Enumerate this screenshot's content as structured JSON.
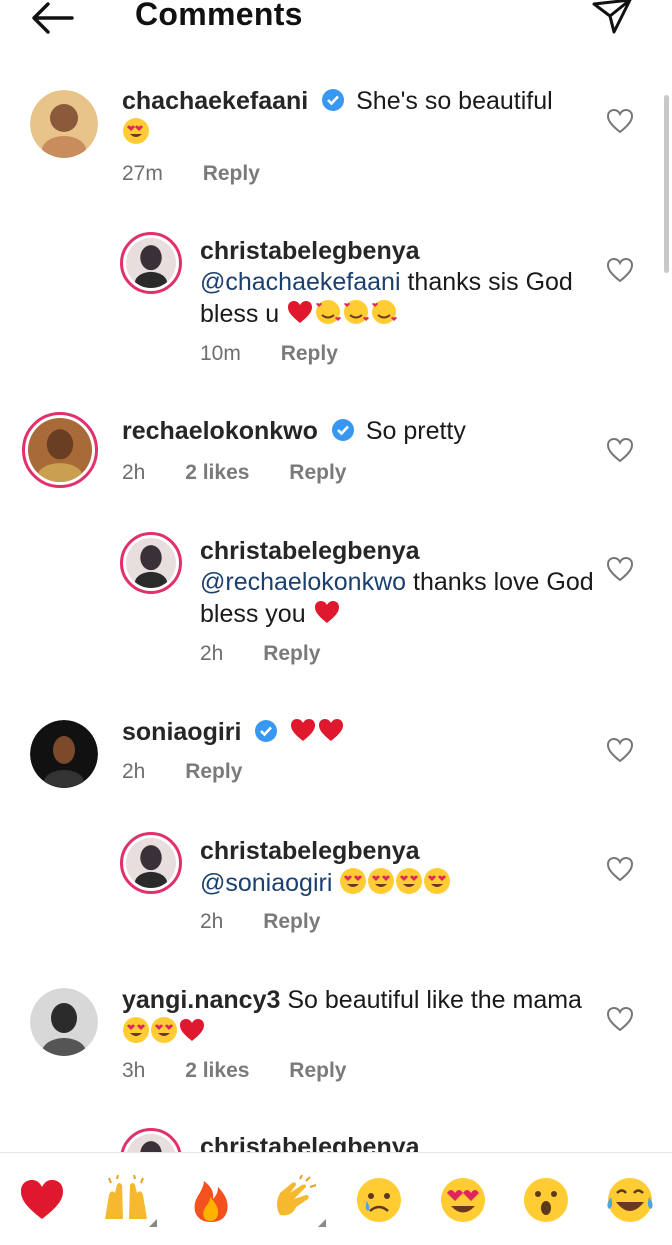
{
  "header": {
    "title": "Comments",
    "back_icon": "arrow-left-icon",
    "send_icon": "paper-plane-icon"
  },
  "comments": [
    {
      "username": "chachaekefaani",
      "verified": true,
      "text": "She's so beautiful",
      "emojis": [
        "heart-eyes"
      ],
      "time": "27m",
      "likes": "",
      "reply_label": "Reply",
      "avatar_color": "#d9a86c"
    },
    {
      "username": "christabelegbenya",
      "verified": false,
      "mention": "@chachaekefaani",
      "text": "thanks sis God bless u",
      "emojis": [
        "red-heart",
        "smiling-hearts",
        "smiling-hearts",
        "smiling-hearts"
      ],
      "time": "10m",
      "likes": "",
      "reply_label": "Reply",
      "avatar_color": "#3a3038"
    },
    {
      "username": "rechaelokonkwo",
      "verified": true,
      "text": "So pretty",
      "emojis": [],
      "time": "2h",
      "likes": "2 likes",
      "reply_label": "Reply",
      "avatar_color": "#b07a4a"
    },
    {
      "username": "christabelegbenya",
      "verified": false,
      "mention": "@rechaelokonkwo",
      "text": "thanks love God bless you",
      "emojis": [
        "red-heart"
      ],
      "time": "2h",
      "likes": "",
      "reply_label": "Reply",
      "avatar_color": "#3a3038"
    },
    {
      "username": "soniaogiri",
      "verified": true,
      "text": "",
      "emojis": [
        "red-heart",
        "red-heart"
      ],
      "time": "2h",
      "likes": "",
      "reply_label": "Reply",
      "avatar_color": "#1a1a1a"
    },
    {
      "username": "christabelegbenya",
      "verified": false,
      "mention": "@soniaogiri",
      "text": "",
      "emojis": [
        "heart-eyes",
        "heart-eyes",
        "heart-eyes",
        "heart-eyes"
      ],
      "time": "2h",
      "likes": "",
      "reply_label": "Reply",
      "avatar_color": "#3a3038"
    },
    {
      "username": "yangi.nancy3",
      "verified": false,
      "text": "So beautiful like the mama",
      "emojis": [
        "heart-eyes",
        "heart-eyes",
        "red-heart"
      ],
      "time": "3h",
      "likes": "2 likes",
      "reply_label": "Reply",
      "avatar_color": "#2b2b2b"
    },
    {
      "username": "christabelegbenya",
      "verified": false,
      "text": "",
      "emojis": [],
      "time": "",
      "likes": "",
      "reply_label": "",
      "avatar_color": "#3a3038"
    }
  ],
  "reactions": [
    "red-heart",
    "raising-hands",
    "fire",
    "clapping-hands",
    "crying-face",
    "heart-eyes",
    "surprised-face",
    "tears-of-joy"
  ],
  "colors": {
    "mention": "#1b3f6e",
    "story_ring": "#e1306c",
    "verified": "#3897f0"
  }
}
